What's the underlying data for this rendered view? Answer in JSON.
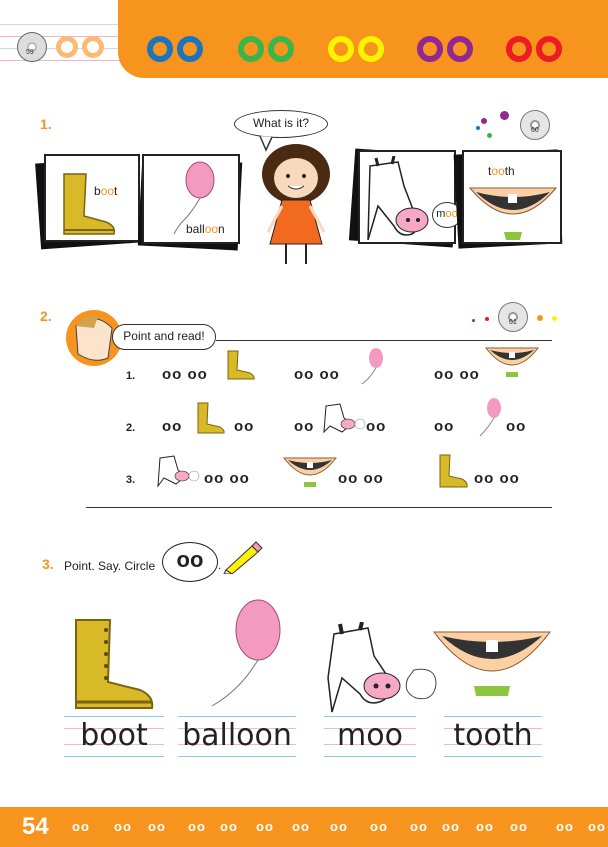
{
  "header": {
    "audio_track": "59",
    "vowel_colors": [
      "#f7941d",
      "#1c75bc",
      "#39b54a",
      "#fff200",
      "#92278f",
      "#ed1c24"
    ]
  },
  "section1": {
    "number": "1.",
    "speech": "What is it?",
    "audio_track": "60",
    "cards": [
      {
        "pre": "b",
        "oo": "oo",
        "post": "t"
      },
      {
        "pre": "ball",
        "oo": "oo",
        "post": "n"
      },
      {
        "pre": "m",
        "oo": "oo",
        "post": ""
      },
      {
        "pre": "t",
        "oo": "oo",
        "post": "th"
      }
    ]
  },
  "section2": {
    "number": "2.",
    "speech": "Point and read!",
    "audio_track": "61",
    "rows": [
      {
        "label": "1.",
        "items": [
          "oo oo",
          "oo oo",
          "oo oo"
        ]
      },
      {
        "label": "2.",
        "items": [
          "oo",
          "oo",
          "oo",
          "oo",
          "oo",
          "oo"
        ]
      },
      {
        "label": "3.",
        "items": [
          "oo oo",
          "oo oo",
          "oo oo"
        ]
      }
    ]
  },
  "section3": {
    "number": "3.",
    "instruction": "Point. Say. Circle",
    "circle_text": "oo",
    "period": ".",
    "words": [
      "boot",
      "balloon",
      "moo",
      "tooth"
    ]
  },
  "footer": {
    "page_number": "54",
    "letters": [
      "oo",
      "oo",
      "oo",
      "oo",
      "oo",
      "oo",
      "oo",
      "oo",
      "oo",
      "oo",
      "oo",
      "oo",
      "oo",
      "oo",
      "oo",
      "oo"
    ]
  },
  "icons": [
    "cd-icon",
    "boot-icon",
    "balloon-icon",
    "girl-icon",
    "cow-icon",
    "tooth-icon",
    "boy-icon",
    "pencil-icon"
  ]
}
